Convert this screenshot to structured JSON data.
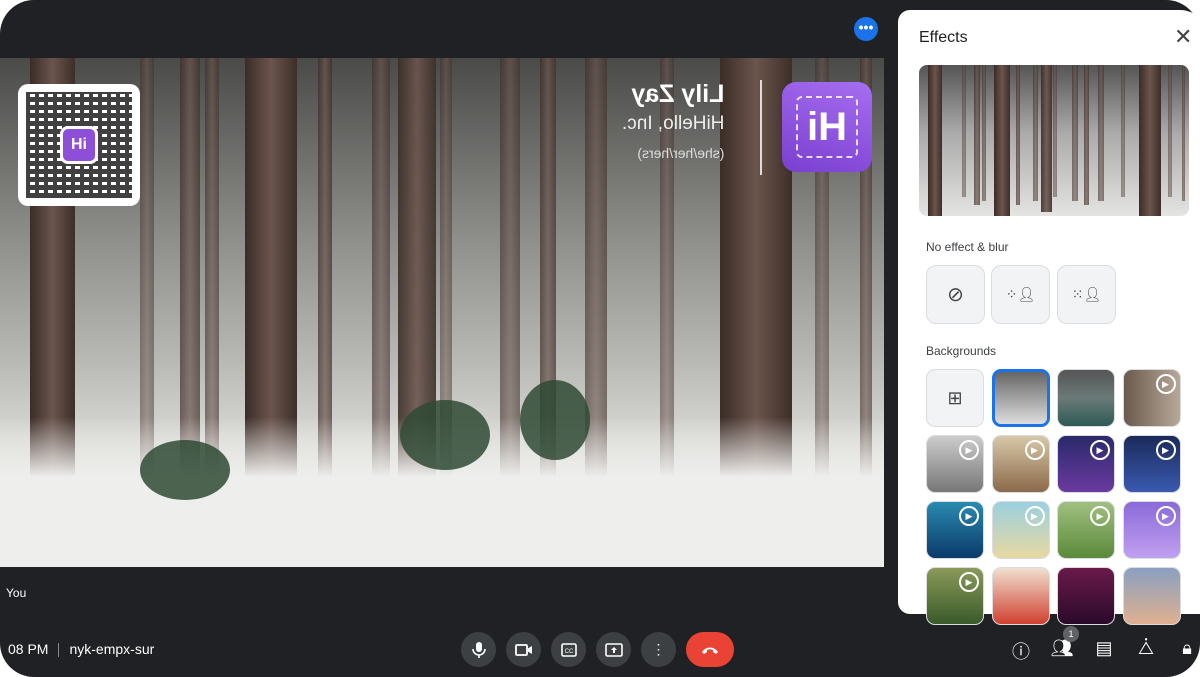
{
  "video": {
    "name_tag": {
      "name": "Lily Zay",
      "company": "HiHello, Inc.",
      "pronouns": "(she/her/hers)"
    },
    "logo_text": "Hi",
    "qr_badge": "Hi",
    "self_label": "You"
  },
  "more_options_icon": "more-horiz-icon",
  "bottom_bar": {
    "time": "08 PM",
    "meeting_code": "nyk-empx-sur",
    "controls": [
      "mic-icon",
      "camera-icon",
      "captions-icon",
      "present-icon",
      "more-vert-icon",
      "end-call-icon"
    ],
    "right_icons": [
      "info-icon",
      "people-icon",
      "chat-icon",
      "activities-icon",
      "host-controls-icon"
    ],
    "people_count": "1"
  },
  "accent_color": "#1a73e8",
  "end_call_color": "#ea4335",
  "effects": {
    "title": "Effects",
    "no_effect_section": "No effect & blur",
    "backgrounds_section": "Backgrounds",
    "options": [
      "no-effect-icon",
      "slight-blur-icon",
      "blur-icon"
    ],
    "backgrounds": [
      {
        "kind": "upload",
        "icon": "add-image-icon"
      },
      {
        "kind": "forest",
        "selected": true
      },
      {
        "kind": "lake"
      },
      {
        "kind": "room",
        "animated": true
      },
      {
        "kind": "window",
        "animated": true
      },
      {
        "kind": "shelf",
        "animated": true
      },
      {
        "kind": "lanterns",
        "animated": true
      },
      {
        "kind": "chair",
        "animated": true
      },
      {
        "kind": "underwater",
        "animated": true
      },
      {
        "kind": "beach",
        "animated": true
      },
      {
        "kind": "castle",
        "animated": true
      },
      {
        "kind": "purple-room",
        "animated": true
      },
      {
        "kind": "jungle",
        "animated": true
      },
      {
        "kind": "koi",
        "animated": false
      },
      {
        "kind": "theater",
        "animated": false
      },
      {
        "kind": "sunset",
        "animated": false
      }
    ]
  }
}
